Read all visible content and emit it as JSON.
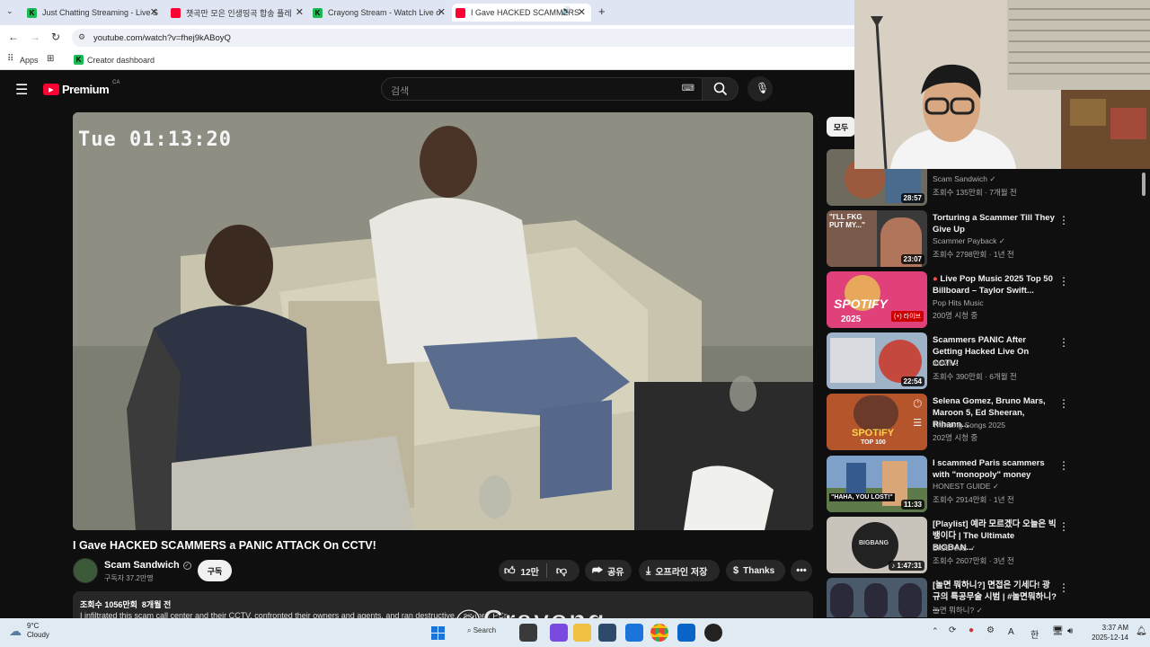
{
  "browser": {
    "tabs": [
      {
        "title": "Just Chatting Streaming - Live S"
      },
      {
        "title": "챗곡만 모은 인생띵곡 합송 플레"
      },
      {
        "title": "Crayong Stream - Watch Live o"
      },
      {
        "title": "I Gave HACKED SCAMMERS"
      }
    ],
    "url": "youtube.com/watch?v=fhej9kABoyQ",
    "bookmarks": {
      "apps": "Apps",
      "creator": "Creator dashboard"
    }
  },
  "youtube": {
    "logo": "Premium",
    "region": "CA",
    "search_placeholder": "검색",
    "video": {
      "overlay_timestamp": "Tue 01:13:20",
      "title": "I Gave HACKED SCAMMERS a PANIC ATTACK On CCTV!",
      "channel": "Scam Sandwich",
      "subscribers": "구독자 37.2만명",
      "subscribe": "구독",
      "likes": "12만",
      "share": "공유",
      "download": "오프라인 저장",
      "thanks": "Thanks",
      "views_date": "조회수 1056만회  8개월 전",
      "description": "I infiltrated this scam call center and their CCTV, confronted their owners and agents, and ran destructive... on their PCs..."
    },
    "chips": {
      "all": "모두"
    },
    "recommendations": [
      {
        "title": "",
        "channel": "Scam Sandwich",
        "meta": "조회수 135만회 · 7개월 전",
        "duration": "28:57",
        "verified": true
      },
      {
        "title": "Torturing a Scammer Till They Give Up",
        "channel": "Scammer Payback",
        "meta": "조회수 2798만회 · 1년 전",
        "duration": "23:07",
        "verified": true
      },
      {
        "title": "Live Pop Music 2025 Top 50 Billboard – Taylor Swift...",
        "channel": "Pop Hits Music",
        "meta": "200명 시청 중",
        "duration": "",
        "verified": false
      },
      {
        "title": "Scammers PANIC After Getting Hacked Live On CCTV!",
        "channel": "mrwn",
        "meta": "조회수 390만회 · 6개월 전",
        "duration": "22:54",
        "verified": true
      },
      {
        "title": "Selena Gomez, Bruno Mars, Maroon 5, Ed Sheeran, Rihann...",
        "channel": "Trending Songs 2025",
        "meta": "202명 시청 중",
        "duration": "",
        "verified": false
      },
      {
        "title": "I scammed Paris scammers with \"monopoly\" money",
        "channel": "HONEST GUIDE",
        "meta": "조회수 2914만회 · 1년 전",
        "duration": "11:33",
        "verified": true
      },
      {
        "title": "[Playlist] 예라 모르겠다 오늘은 빅뱅이다 | The Ultimate BIGBAN...",
        "channel": "BIGBANG",
        "meta": "조회수 2607만회 · 3년 전",
        "duration": "1:47:31",
        "verified": true
      },
      {
        "title": "[놀면 뭐하니?] 면접은 기세다! 광규의 특공무술 시범 | #놀면뭐하니? ...",
        "channel": "놀면 뭐하니?",
        "meta": "",
        "duration": "",
        "verified": true
      }
    ],
    "thumb_texts": {
      "t1": "\"I'LL FKG PUT MY...\"",
      "t2a": "SPOTIFY",
      "t2b": "2025",
      "t2c": "(+) 라이브",
      "t3a": "SPOTIFY",
      "t3b": "TOP 100",
      "t4": "\"HAHA, YOU LOST!\"",
      "t5": "BIGBANG"
    }
  },
  "watermark": "@Crayong",
  "taskbar": {
    "weather_temp": "9°C",
    "weather_desc": "Cloudy",
    "search": "Search",
    "lang": "A",
    "ime": "한",
    "time": "3:37 AM",
    "date": "2025-12-14"
  },
  "colors": {
    "yt_red": "#ff0033",
    "bg": "#0f0f0f",
    "pill": "#272727"
  }
}
